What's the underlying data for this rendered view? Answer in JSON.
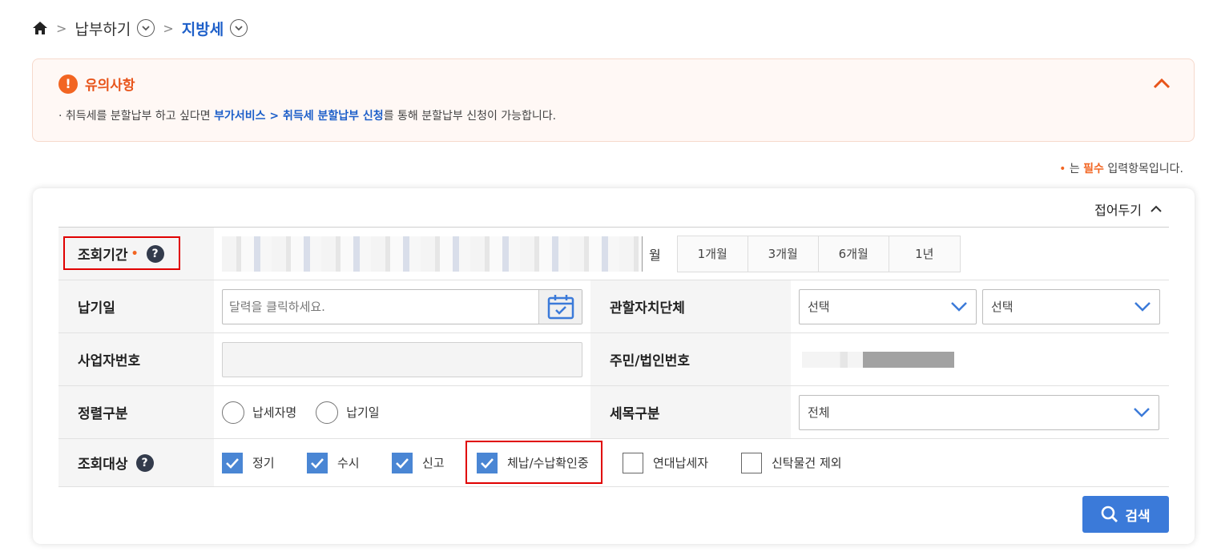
{
  "breadcrumb": {
    "items": [
      "납부하기",
      "지방세"
    ]
  },
  "notice": {
    "title": "유의사항",
    "text_prefix": "· 취득세를 분할납부 하고 싶다면 ",
    "text_link": "부가서비스 > 취득세 분할납부 신청",
    "text_suffix": "를 통해 분할납부 신청이 가능합니다."
  },
  "required_note": {
    "bullet": "•",
    "prefix": " 는 ",
    "highlight": "필수",
    "suffix": " 입력항목입니다."
  },
  "card": {
    "fold_label": "접어두기",
    "search_label": "검색"
  },
  "form": {
    "period": {
      "label": "조회기간",
      "required_mark": "•",
      "unit": "월",
      "buttons": [
        "1개월",
        "3개월",
        "6개월",
        "1년"
      ]
    },
    "pay_date": {
      "label": "납기일",
      "placeholder": "달력을 클릭하세요."
    },
    "jurisdiction": {
      "label": "관할자치단체",
      "select1": "선택",
      "select2": "선택"
    },
    "biz_number": {
      "label": "사업자번호"
    },
    "resident_number": {
      "label": "주민/법인번호"
    },
    "sort": {
      "label": "정렬구분",
      "options": [
        "납세자명",
        "납기일"
      ]
    },
    "tax_type": {
      "label": "세목구분",
      "value": "전체"
    },
    "target": {
      "label": "조회대상",
      "options": [
        {
          "label": "정기",
          "checked": true
        },
        {
          "label": "수시",
          "checked": true
        },
        {
          "label": "신고",
          "checked": true
        },
        {
          "label": "체납/수납확인중",
          "checked": true
        },
        {
          "label": "연대납세자",
          "checked": false
        },
        {
          "label": "신탁물건 제외",
          "checked": false
        }
      ]
    }
  },
  "colors": {
    "accent_blue": "#3b7ad9",
    "breadcrumb_active": "#1d5fc9",
    "warning_orange": "#f26522",
    "highlight_red": "#e00000"
  }
}
